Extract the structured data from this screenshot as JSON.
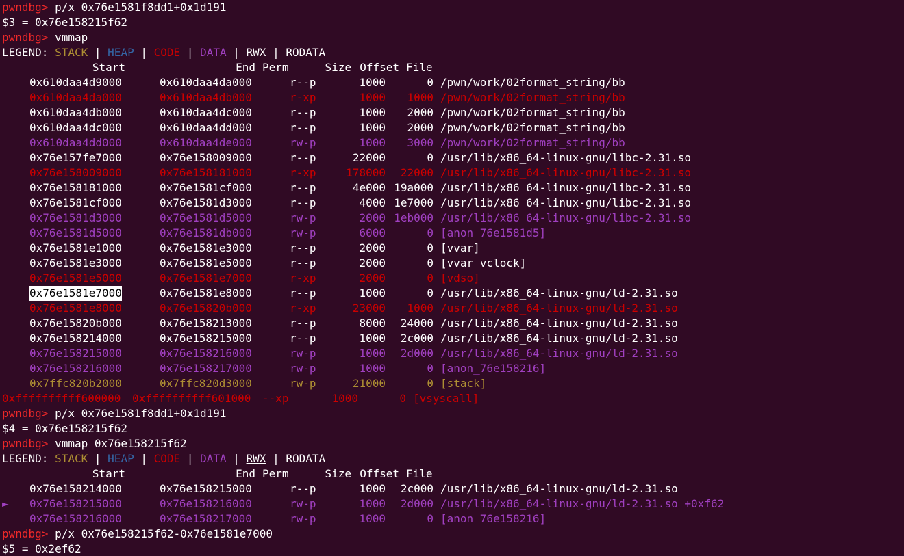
{
  "prompt": "pwndbg>",
  "commands": {
    "cmd1": "p/x 0x76e1581f8dd1+0x1d191",
    "res1": "$3 = 0x76e158215f62",
    "cmd2": "vmmap",
    "cmd3": "p/x 0x76e1581f8dd1+0x1d191",
    "res3": "$4 = 0x76e158215f62",
    "cmd4": "vmmap 0x76e158215f62",
    "cmd5": "p/x 0x76e158215f62-0x76e1581e7000",
    "res5": "$5 = 0x2ef62"
  },
  "legend": {
    "label": "LEGEND:",
    "stack": "STACK",
    "heap": "HEAP",
    "code": "CODE",
    "data": "DATA",
    "rwx": "RWX",
    "rodata": "RODATA",
    "sep": "|"
  },
  "header": {
    "start": "Start",
    "end": "End",
    "perm": "Perm",
    "size": "Size",
    "offset": "Offset",
    "file": "File"
  },
  "vmmap1": [
    {
      "start": "0x610daa4d9000",
      "end": "0x610daa4da000",
      "perm": "r--p",
      "size": "1000",
      "offset": "0",
      "file": "/pwn/work/02format_string/bb",
      "kind": "ro"
    },
    {
      "start": "0x610daa4da000",
      "end": "0x610daa4db000",
      "perm": "r-xp",
      "size": "1000",
      "offset": "1000",
      "file": "/pwn/work/02format_string/bb",
      "kind": "code"
    },
    {
      "start": "0x610daa4db000",
      "end": "0x610daa4dc000",
      "perm": "r--p",
      "size": "1000",
      "offset": "2000",
      "file": "/pwn/work/02format_string/bb",
      "kind": "ro"
    },
    {
      "start": "0x610daa4dc000",
      "end": "0x610daa4dd000",
      "perm": "r--p",
      "size": "1000",
      "offset": "2000",
      "file": "/pwn/work/02format_string/bb",
      "kind": "ro"
    },
    {
      "start": "0x610daa4dd000",
      "end": "0x610daa4de000",
      "perm": "rw-p",
      "size": "1000",
      "offset": "3000",
      "file": "/pwn/work/02format_string/bb",
      "kind": "data"
    },
    {
      "start": "0x76e157fe7000",
      "end": "0x76e158009000",
      "perm": "r--p",
      "size": "22000",
      "offset": "0",
      "file": "/usr/lib/x86_64-linux-gnu/libc-2.31.so",
      "kind": "ro"
    },
    {
      "start": "0x76e158009000",
      "end": "0x76e158181000",
      "perm": "r-xp",
      "size": "178000",
      "offset": "22000",
      "file": "/usr/lib/x86_64-linux-gnu/libc-2.31.so",
      "kind": "code"
    },
    {
      "start": "0x76e158181000",
      "end": "0x76e1581cf000",
      "perm": "r--p",
      "size": "4e000",
      "offset": "19a000",
      "file": "/usr/lib/x86_64-linux-gnu/libc-2.31.so",
      "kind": "ro"
    },
    {
      "start": "0x76e1581cf000",
      "end": "0x76e1581d3000",
      "perm": "r--p",
      "size": "4000",
      "offset": "1e7000",
      "file": "/usr/lib/x86_64-linux-gnu/libc-2.31.so",
      "kind": "ro"
    },
    {
      "start": "0x76e1581d3000",
      "end": "0x76e1581d5000",
      "perm": "rw-p",
      "size": "2000",
      "offset": "1eb000",
      "file": "/usr/lib/x86_64-linux-gnu/libc-2.31.so",
      "kind": "data"
    },
    {
      "start": "0x76e1581d5000",
      "end": "0x76e1581db000",
      "perm": "rw-p",
      "size": "6000",
      "offset": "0",
      "file": "[anon_76e1581d5]",
      "kind": "data"
    },
    {
      "start": "0x76e1581e1000",
      "end": "0x76e1581e3000",
      "perm": "r--p",
      "size": "2000",
      "offset": "0",
      "file": "[vvar]",
      "kind": "ro"
    },
    {
      "start": "0x76e1581e3000",
      "end": "0x76e1581e5000",
      "perm": "r--p",
      "size": "2000",
      "offset": "0",
      "file": "[vvar_vclock]",
      "kind": "ro"
    },
    {
      "start": "0x76e1581e5000",
      "end": "0x76e1581e7000",
      "perm": "r-xp",
      "size": "2000",
      "offset": "0",
      "file": "[vdso]",
      "kind": "code"
    },
    {
      "start": "0x76e1581e7000",
      "end": "0x76e1581e8000",
      "perm": "r--p",
      "size": "1000",
      "offset": "0",
      "file": "/usr/lib/x86_64-linux-gnu/ld-2.31.so",
      "kind": "ro",
      "selected": true
    },
    {
      "start": "0x76e1581e8000",
      "end": "0x76e15820b000",
      "perm": "r-xp",
      "size": "23000",
      "offset": "1000",
      "file": "/usr/lib/x86_64-linux-gnu/ld-2.31.so",
      "kind": "code"
    },
    {
      "start": "0x76e15820b000",
      "end": "0x76e158213000",
      "perm": "r--p",
      "size": "8000",
      "offset": "24000",
      "file": "/usr/lib/x86_64-linux-gnu/ld-2.31.so",
      "kind": "ro"
    },
    {
      "start": "0x76e158214000",
      "end": "0x76e158215000",
      "perm": "r--p",
      "size": "1000",
      "offset": "2c000",
      "file": "/usr/lib/x86_64-linux-gnu/ld-2.31.so",
      "kind": "ro"
    },
    {
      "start": "0x76e158215000",
      "end": "0x76e158216000",
      "perm": "rw-p",
      "size": "1000",
      "offset": "2d000",
      "file": "/usr/lib/x86_64-linux-gnu/ld-2.31.so",
      "kind": "data"
    },
    {
      "start": "0x76e158216000",
      "end": "0x76e158217000",
      "perm": "rw-p",
      "size": "1000",
      "offset": "0",
      "file": "[anon_76e158216]",
      "kind": "data"
    },
    {
      "start": "0x7ffc820b2000",
      "end": "0x7ffc820d3000",
      "perm": "rw-p",
      "size": "21000",
      "offset": "0",
      "file": "[stack]",
      "kind": "stack"
    },
    {
      "start": "0xffffffffff600000",
      "end": "0xffffffffff601000",
      "perm": "--xp",
      "size": "1000",
      "offset": "0",
      "file": "[vsyscall]",
      "kind": "code",
      "wide": true
    }
  ],
  "vmmap2": [
    {
      "start": "0x76e158214000",
      "end": "0x76e158215000",
      "perm": "r--p",
      "size": "1000",
      "offset": "2c000",
      "file": "/usr/lib/x86_64-linux-gnu/ld-2.31.so",
      "kind": "ro"
    },
    {
      "start": "0x76e158215000",
      "end": "0x76e158216000",
      "perm": "rw-p",
      "size": "1000",
      "offset": "2d000",
      "file": "/usr/lib/x86_64-linux-gnu/ld-2.31.so +0xf62",
      "kind": "data",
      "marker": "►"
    },
    {
      "start": "0x76e158216000",
      "end": "0x76e158217000",
      "perm": "rw-p",
      "size": "1000",
      "offset": "0",
      "file": "[anon_76e158216]",
      "kind": "data"
    }
  ],
  "colors": {
    "background": "#300a24",
    "prompt": "#ef2929",
    "stack": "#ad8e33",
    "heap": "#3465a4",
    "code": "#cc0000",
    "data": "#a040c0",
    "text": "#ffffff"
  }
}
